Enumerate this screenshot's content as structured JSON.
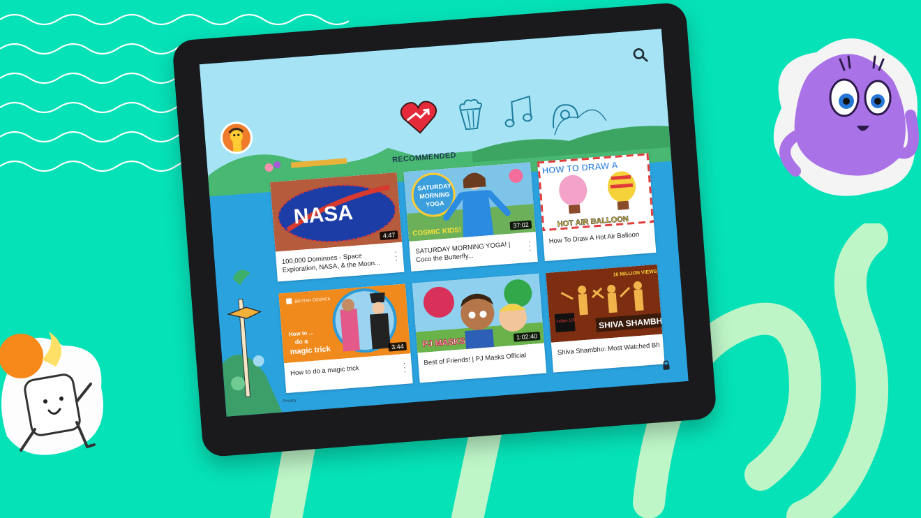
{
  "app": {
    "section_title": "RECOMMENDED",
    "privacy_label": "Privacy"
  },
  "icons": {
    "search": "search-icon",
    "lock": "lock-icon",
    "avatar": "profile-avatar",
    "tabs": [
      "recommended-heart-icon",
      "shows-popcorn-icon",
      "music-icon",
      "explore-icon"
    ]
  },
  "colors": {
    "background": "#06e2b8",
    "screen_blue": "#2aa2de",
    "sky": "#a6e3f5",
    "heart_red": "#e52b3a"
  },
  "videos": [
    {
      "title": "100,000 Dominoes - Space Exploration, NASA, & the Moon...",
      "duration": "4:47"
    },
    {
      "title": "SATURDAY MORNING YOGA! | Coco the Butterfly...",
      "duration": "37:02"
    },
    {
      "title": "How To Draw A Hot Air Balloon",
      "duration": ""
    },
    {
      "title": "How to do a magic trick",
      "duration": "3:44"
    },
    {
      "title": "Best of Friends! | PJ Masks Official",
      "duration": "1:02:40"
    },
    {
      "title": "Shiva Shambho: Most Watched Bh",
      "duration": ""
    }
  ],
  "thumb_text": {
    "nasa": "NASA",
    "yoga_line1": "SATURDAY",
    "yoga_line2": "MORNING",
    "yoga_line3": "YOGA",
    "cosmic": "COSMIC KIDS!",
    "balloon_top": "HOW TO DRAW A",
    "balloon_bottom": "HOT AIR BALLOON",
    "british_council": "BRITISH COUNCIL",
    "magic_line1": "How to ...",
    "magic_line2": "do a",
    "magic_line3": "magic trick",
    "pjmasks": "PJ MASKS",
    "shiva_views": "10 MILLION VIEWS",
    "shiva_brand": "indian 100",
    "shiva_title": "SHIVA SHAMBH"
  }
}
